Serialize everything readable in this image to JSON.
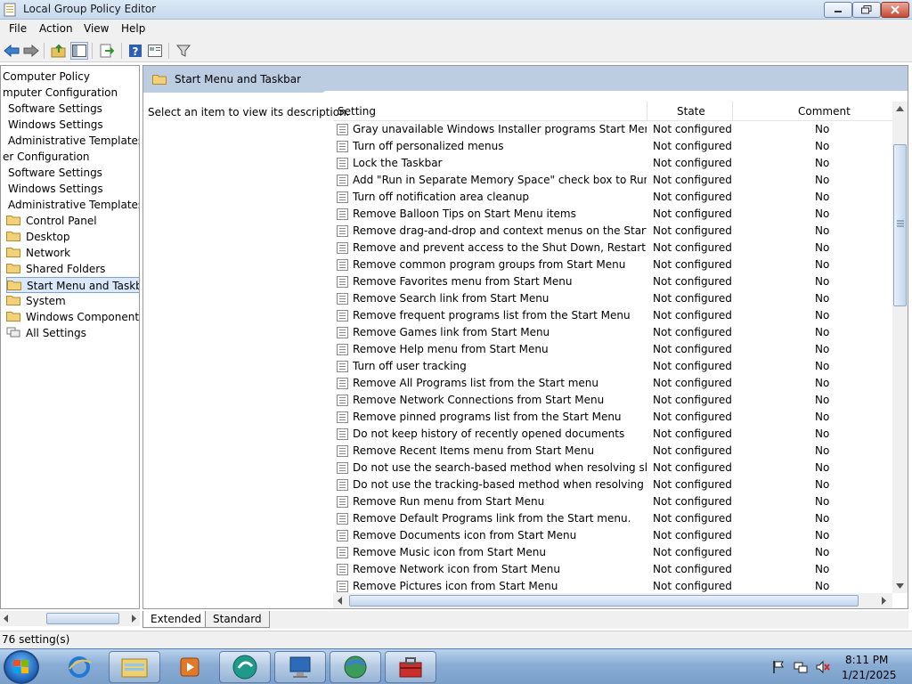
{
  "window": {
    "title": "Local Group Policy Editor"
  },
  "menu": [
    "File",
    "Action",
    "View",
    "Help"
  ],
  "toolbar_icons": [
    "back-arrow-icon",
    "forward-arrow-icon",
    "up-folder-icon",
    "show-hide-tree-icon",
    "export-list-icon",
    "help-icon",
    "properties-icon",
    "filter-icon"
  ],
  "tree": [
    {
      "label": "Computer Policy",
      "indent": 0
    },
    {
      "label": "mputer Configuration",
      "indent": 0
    },
    {
      "label": "Software Settings",
      "indent": 1
    },
    {
      "label": "Windows Settings",
      "indent": 1
    },
    {
      "label": "Administrative Templates",
      "indent": 1
    },
    {
      "label": "er Configuration",
      "indent": 0
    },
    {
      "label": "Software Settings",
      "indent": 1
    },
    {
      "label": "Windows Settings",
      "indent": 1
    },
    {
      "label": "Administrative Templates",
      "indent": 1
    },
    {
      "label": "Control Panel",
      "indent": 2,
      "folder": true
    },
    {
      "label": "Desktop",
      "indent": 2,
      "folder": true
    },
    {
      "label": "Network",
      "indent": 2,
      "folder": true
    },
    {
      "label": "Shared Folders",
      "indent": 2,
      "folder": true
    },
    {
      "label": "Start Menu and Taskbar",
      "indent": 2,
      "folder": true,
      "selected": true
    },
    {
      "label": "System",
      "indent": 2,
      "folder": true
    },
    {
      "label": "Windows Components",
      "indent": 2,
      "folder": true
    },
    {
      "label": "All Settings",
      "indent": 2,
      "folder": true,
      "special": true
    }
  ],
  "right": {
    "header_title": "Start Menu and Taskbar",
    "description": "Select an item to view its description.",
    "columns": {
      "setting": "Setting",
      "state": "State",
      "comment": "Comment"
    }
  },
  "rows": [
    {
      "setting": "Gray unavailable Windows Installer programs Start Menu sh...",
      "state": "Not configured",
      "comment": "No"
    },
    {
      "setting": "Turn off personalized menus",
      "state": "Not configured",
      "comment": "No"
    },
    {
      "setting": "Lock the Taskbar",
      "state": "Not configured",
      "comment": "No"
    },
    {
      "setting": "Add \"Run in Separate Memory Space\" check box to Run dial...",
      "state": "Not configured",
      "comment": "No"
    },
    {
      "setting": "Turn off notification area cleanup",
      "state": "Not configured",
      "comment": "No"
    },
    {
      "setting": "Remove Balloon Tips on Start Menu items",
      "state": "Not configured",
      "comment": "No"
    },
    {
      "setting": "Remove drag-and-drop and context menus on the Start Me...",
      "state": "Not configured",
      "comment": "No"
    },
    {
      "setting": "Remove and prevent access to the Shut Down, Restart, Sleep...",
      "state": "Not configured",
      "comment": "No"
    },
    {
      "setting": "Remove common program groups from Start Menu",
      "state": "Not configured",
      "comment": "No"
    },
    {
      "setting": "Remove Favorites menu from Start Menu",
      "state": "Not configured",
      "comment": "No"
    },
    {
      "setting": "Remove Search link from Start Menu",
      "state": "Not configured",
      "comment": "No"
    },
    {
      "setting": "Remove frequent programs list from the Start Menu",
      "state": "Not configured",
      "comment": "No"
    },
    {
      "setting": "Remove Games link from Start Menu",
      "state": "Not configured",
      "comment": "No"
    },
    {
      "setting": "Remove Help menu from Start Menu",
      "state": "Not configured",
      "comment": "No"
    },
    {
      "setting": "Turn off user tracking",
      "state": "Not configured",
      "comment": "No"
    },
    {
      "setting": "Remove All Programs list from the Start menu",
      "state": "Not configured",
      "comment": "No"
    },
    {
      "setting": "Remove Network Connections from Start Menu",
      "state": "Not configured",
      "comment": "No"
    },
    {
      "setting": "Remove pinned programs list from the Start Menu",
      "state": "Not configured",
      "comment": "No"
    },
    {
      "setting": "Do not keep history of recently opened documents",
      "state": "Not configured",
      "comment": "No"
    },
    {
      "setting": "Remove Recent Items menu from Start Menu",
      "state": "Not configured",
      "comment": "No"
    },
    {
      "setting": "Do not use the search-based method when resolving shell s...",
      "state": "Not configured",
      "comment": "No"
    },
    {
      "setting": "Do not use the tracking-based method when resolving shell ...",
      "state": "Not configured",
      "comment": "No"
    },
    {
      "setting": "Remove Run menu from Start Menu",
      "state": "Not configured",
      "comment": "No"
    },
    {
      "setting": "Remove Default Programs link from the Start menu.",
      "state": "Not configured",
      "comment": "No"
    },
    {
      "setting": "Remove Documents icon from Start Menu",
      "state": "Not configured",
      "comment": "No"
    },
    {
      "setting": "Remove Music icon from Start Menu",
      "state": "Not configured",
      "comment": "No"
    },
    {
      "setting": "Remove Network icon from Start Menu",
      "state": "Not configured",
      "comment": "No"
    },
    {
      "setting": "Remove Pictures icon from Start Menu",
      "state": "Not configured",
      "comment": "No"
    }
  ],
  "tabs": [
    "Extended",
    "Standard"
  ],
  "status": "76 setting(s)",
  "taskbar": {
    "apps": [
      "internet-explorer-icon",
      "windows-explorer-icon",
      "media-player-icon",
      "app-icon",
      "remote-desktop-icon",
      "browser-globe-icon",
      "toolbox-icon"
    ],
    "time": "8:11 PM",
    "date": "1/21/2025"
  },
  "colors": {
    "header_band": "#bccde2",
    "selection": "#d9e8fb",
    "taskbar": "#89acd4"
  }
}
